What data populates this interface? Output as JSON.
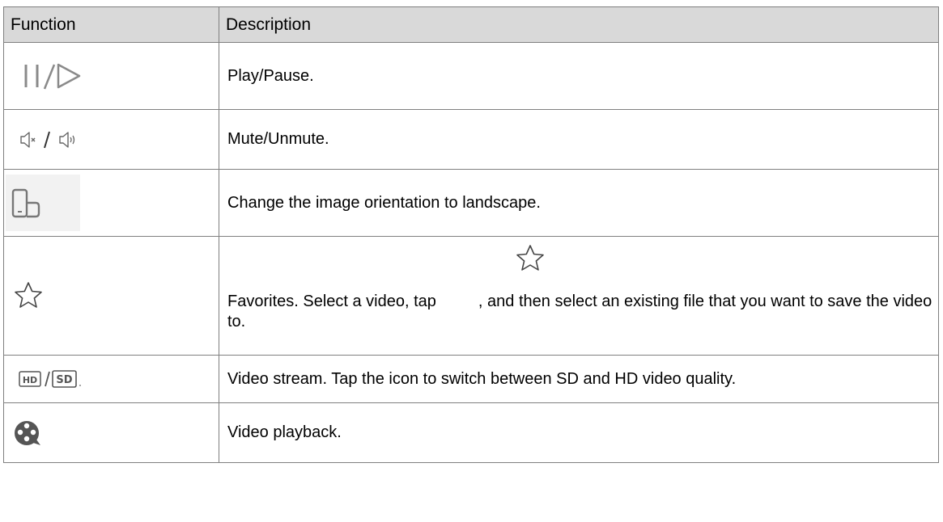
{
  "table": {
    "header": {
      "function": "Function",
      "description": "Description"
    },
    "rows": [
      {
        "icon": "pause-play-icon",
        "description": "Play/Pause."
      },
      {
        "icon": "mute-unmute-icon",
        "description": "Mute/Unmute."
      },
      {
        "icon": "landscape-rotate-icon",
        "description": "Change the image orientation to landscape."
      },
      {
        "icon": "star-icon",
        "description_part1": "Favorites. Select a video, tap",
        "description_part2": ", and then select an existing file that you want to save the video to."
      },
      {
        "icon": "hd-sd-icon",
        "hd_label": "HD",
        "sd_label": "SD",
        "description": "Video stream. Tap the icon to switch between SD and HD video quality."
      },
      {
        "icon": "video-playback-icon",
        "description": "Video playback."
      }
    ]
  }
}
